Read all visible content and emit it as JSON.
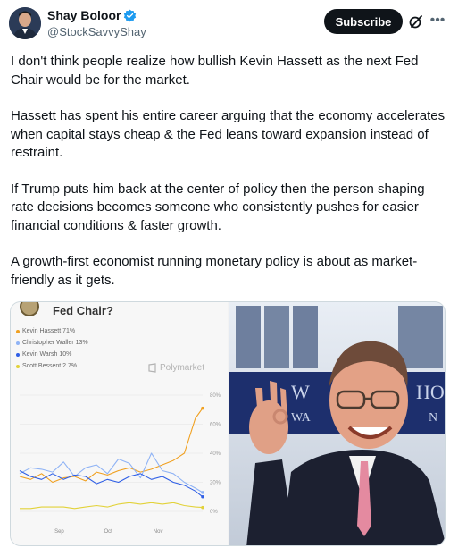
{
  "author": {
    "display_name": "Shay Boloor",
    "handle": "@StockSavvyShay"
  },
  "actions": {
    "subscribe_label": "Subscribe"
  },
  "tweet": {
    "paragraphs": [
      "I don't think people realize how bullish Kevin Hassett as the next Fed Chair would be for the market.",
      "Hassett has spent his entire career arguing that the economy accelerates when capital stays cheap & the Fed leans toward expansion instead of restraint.",
      "If Trump puts him back at the center of policy then the person shaping rate decisions becomes someone who consistently pushes for easier financial conditions & faster growth.",
      "A growth-first economist running monetary policy is about as market-friendly as it gets."
    ]
  },
  "media": {
    "photo_background_text": "W",
    "photo_background_text_2": "WA",
    "photo_background_text_3": "HO",
    "photo_background_text_4": "N"
  },
  "chart_data": {
    "type": "line",
    "title": "Fed Chair?",
    "source_label": "Polymarket",
    "legend": [
      {
        "label": "Kevin Hassett 71%",
        "color": "#f0a020"
      },
      {
        "label": "Christopher Waller 13%",
        "color": "#8fb3f5"
      },
      {
        "label": "Kevin Warsh 10%",
        "color": "#2f5fe6"
      },
      {
        "label": "Scott Bessent 2.7%",
        "color": "#e2d23a"
      }
    ],
    "x_ticks": [
      "Sep",
      "Oct",
      "Nov"
    ],
    "y_ticks": [
      "80%",
      "60%",
      "40%",
      "20%",
      "0%"
    ],
    "ylim": [
      0,
      80
    ],
    "x": [
      0,
      6,
      12,
      18,
      24,
      30,
      36,
      42,
      48,
      54,
      60,
      66,
      72,
      78,
      84,
      90,
      96,
      100
    ],
    "series": [
      {
        "name": "Kevin Hassett",
        "color": "#f0a020",
        "values": [
          24,
          22,
          26,
          20,
          23,
          24,
          21,
          27,
          25,
          28,
          30,
          27,
          29,
          32,
          35,
          40,
          64,
          71
        ]
      },
      {
        "name": "Christopher Waller",
        "color": "#8fb3f5",
        "values": [
          26,
          30,
          29,
          27,
          34,
          24,
          30,
          32,
          26,
          36,
          33,
          23,
          40,
          28,
          26,
          20,
          16,
          13
        ]
      },
      {
        "name": "Kevin Warsh",
        "color": "#2f5fe6",
        "values": [
          28,
          24,
          22,
          26,
          22,
          25,
          24,
          19,
          22,
          20,
          24,
          26,
          22,
          24,
          20,
          18,
          14,
          10
        ]
      },
      {
        "name": "Scott Bessent",
        "color": "#e2d23a",
        "values": [
          2,
          2,
          3,
          3,
          3,
          2,
          3,
          4,
          3,
          5,
          6,
          5,
          6,
          5,
          6,
          4,
          3,
          2.7
        ]
      }
    ]
  }
}
